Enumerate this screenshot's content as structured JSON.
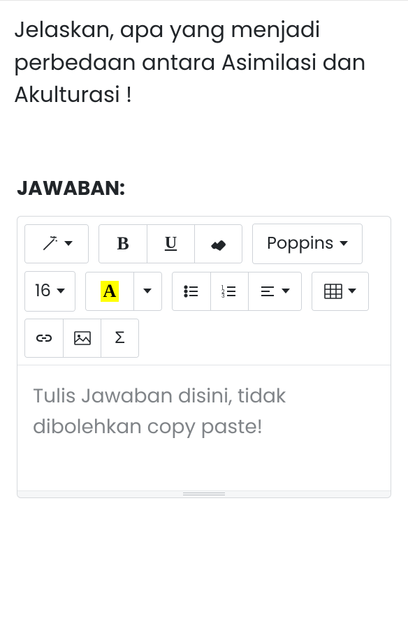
{
  "question": "Jelaskan, apa yang menjadi perbedaan antara Asimilasi dan Akulturasi !",
  "answer_label": "JAWABAN:",
  "toolbar": {
    "font_family": "Poppins",
    "font_size": "16",
    "font_color_letter": "A",
    "bold_symbol": "B",
    "underline_symbol": "U",
    "math_symbol": "Σ"
  },
  "editor": {
    "placeholder": "Tulis Jawaban disini, tidak dibolehkan copy paste!"
  }
}
